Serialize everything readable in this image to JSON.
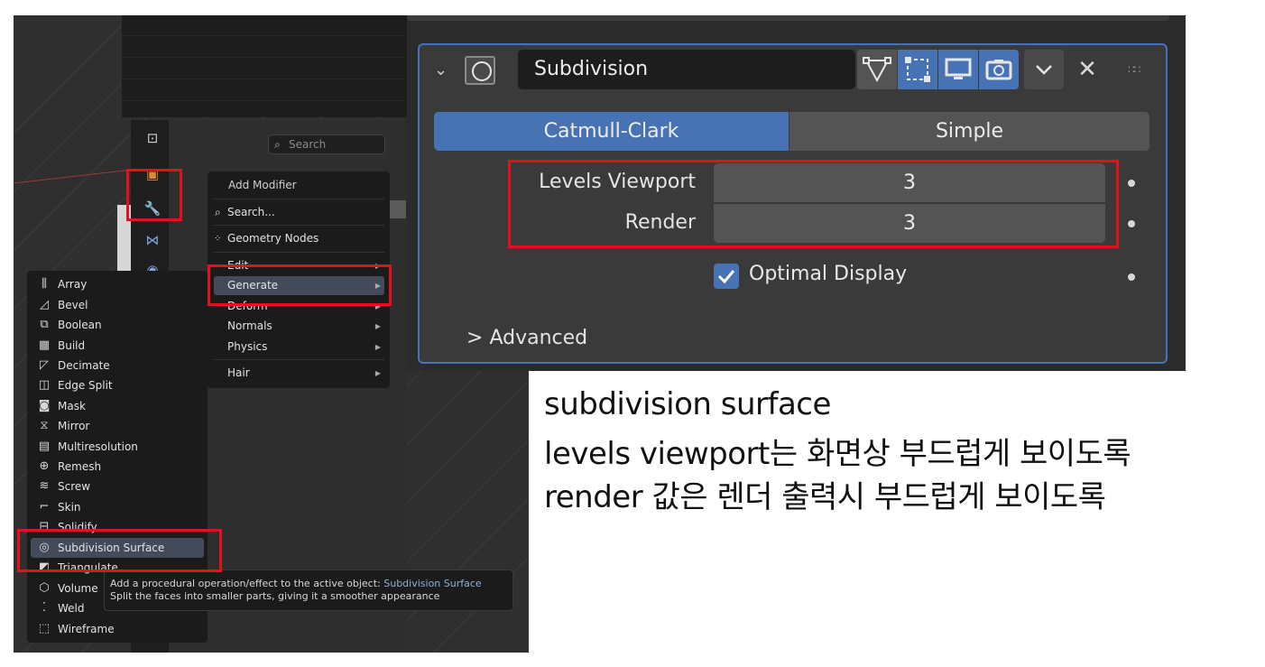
{
  "search": {
    "placeholder": "Search"
  },
  "add_menu": {
    "title": "Add Modifier",
    "items": [
      {
        "label": "Search...",
        "icon": "search-icon"
      },
      {
        "label": "Geometry Nodes",
        "icon": "geometry-nodes-icon"
      },
      {
        "label": "Edit",
        "icon": "submenu-arrow-icon"
      },
      {
        "label": "Generate",
        "icon": "submenu-arrow-icon"
      },
      {
        "label": "Deform",
        "icon": "submenu-arrow-icon"
      },
      {
        "label": "Normals",
        "icon": "submenu-arrow-icon"
      },
      {
        "label": "Physics",
        "icon": "submenu-arrow-icon"
      },
      {
        "label": "Hair",
        "icon": "submenu-arrow-icon"
      }
    ]
  },
  "generate_menu": {
    "items": [
      {
        "label": "Array"
      },
      {
        "label": "Bevel"
      },
      {
        "label": "Boolean"
      },
      {
        "label": "Build"
      },
      {
        "label": "Decimate"
      },
      {
        "label": "Edge Split"
      },
      {
        "label": "Mask"
      },
      {
        "label": "Mirror"
      },
      {
        "label": "Multiresolution"
      },
      {
        "label": "Remesh"
      },
      {
        "label": "Screw"
      },
      {
        "label": "Skin"
      },
      {
        "label": "Solidify"
      },
      {
        "label": "Subdivision Surface"
      },
      {
        "label": "Triangulate"
      },
      {
        "label": "Volume"
      },
      {
        "label": "Weld"
      },
      {
        "label": "Wireframe"
      }
    ]
  },
  "tooltip": {
    "line1": "Add a procedural operation/effect to the active object:",
    "line1_name": "Subdivision Surface",
    "line2": "Split the faces into smaller parts, giving it a smoother appearance"
  },
  "modifier": {
    "name": "Subdivision",
    "modes": [
      "Catmull-Clark",
      "Simple"
    ],
    "levels_viewport_label": "Levels Viewport",
    "levels_viewport_value": "3",
    "render_label": "Render",
    "render_value": "3",
    "optimal_display_label": "Optimal Display",
    "optimal_display_checked": true,
    "advanced_label": "Advanced",
    "accent_color": "#4772b3",
    "selected_mode": "Catmull-Clark"
  },
  "notes": {
    "line1": "subdivision surface",
    "line2": "levels viewport는 화면상 부드럽게 보이도록",
    "line3": "render 값은 렌더 출력시 부드럽게 보이도록"
  },
  "highlight_color": "#e4101f"
}
